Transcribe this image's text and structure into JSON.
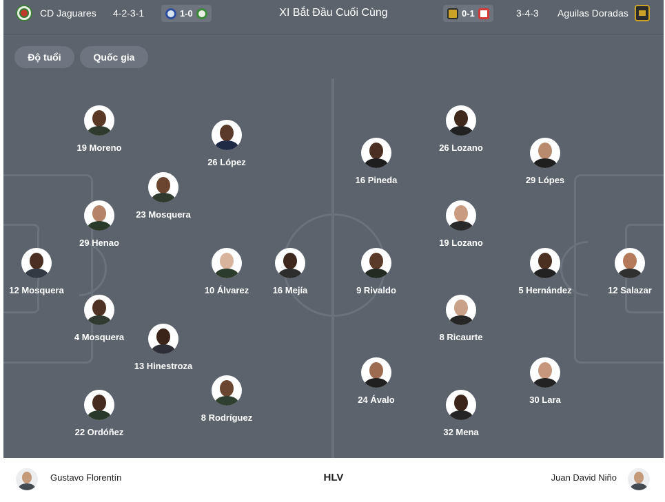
{
  "header": {
    "home_team": "CD Jaguares",
    "home_formation": "4-2-3-1",
    "home_last_score": "1-0",
    "title": "XI Bắt Đầu Cuối Cùng",
    "away_last_score": "0-1",
    "away_formation": "3-4-3",
    "away_team": "Aguilas Doradas"
  },
  "filters": [
    "Độ tuổi",
    "Quốc gia"
  ],
  "home_players": [
    {
      "label": "19 Moreno",
      "skin": "#5a3826",
      "shirt": "#2f3a2f"
    },
    {
      "label": "26 López",
      "skin": "#5b3a2a",
      "shirt": "#1f2a44"
    },
    {
      "label": "23 Mosquera",
      "skin": "#6b4530",
      "shirt": "#2e3b2e"
    },
    {
      "label": "29 Henao",
      "skin": "#b5836a",
      "shirt": "#2b3b2b"
    },
    {
      "label": "12 Mosquera",
      "skin": "#4a2f22",
      "shirt": "#333a44"
    },
    {
      "label": "10 Álvarez",
      "skin": "#d8b49c",
      "shirt": "#2c3c2c"
    },
    {
      "label": "16 Mejía",
      "skin": "#3e281d",
      "shirt": "#2d2d2d"
    },
    {
      "label": "4 Mosquera",
      "skin": "#4e3224",
      "shirt": "#303a30"
    },
    {
      "label": "13 Hinestroza",
      "skin": "#3a241a",
      "shirt": "#2e2e36"
    },
    {
      "label": "22 Ordóñez",
      "skin": "#442b1f",
      "shirt": "#2a3a2a"
    },
    {
      "label": "8 Rodríguez",
      "skin": "#6a452f",
      "shirt": "#304030"
    }
  ],
  "away_players": [
    {
      "label": "16 Pineda",
      "skin": "#4a2f22",
      "shirt": "#1e1e1e"
    },
    {
      "label": "26 Lozano",
      "skin": "#3f281c",
      "shirt": "#222222"
    },
    {
      "label": "29 Lópes",
      "skin": "#b88a6e",
      "shirt": "#1f1f1f"
    },
    {
      "label": "19 Lozano",
      "skin": "#c99b80",
      "shirt": "#2a2a2a"
    },
    {
      "label": "9 Rivaldo",
      "skin": "#5a3a28",
      "shirt": "#222a22"
    },
    {
      "label": "5 Hernández",
      "skin": "#4b2f20",
      "shirt": "#222222"
    },
    {
      "label": "12 Salazar",
      "skin": "#b47a5a",
      "shirt": "#303030"
    },
    {
      "label": "8 Ricaurte",
      "skin": "#c9a088",
      "shirt": "#262626"
    },
    {
      "label": "24 Ávalo",
      "skin": "#9c6b50",
      "shirt": "#202020"
    },
    {
      "label": "32 Mena",
      "skin": "#3b251a",
      "shirt": "#252525"
    },
    {
      "label": "30 Lara",
      "skin": "#c6977c",
      "shirt": "#232323"
    }
  ],
  "footer": {
    "home_coach": "Gustavo Florentín",
    "center_label": "HLV",
    "away_coach": "Juan David Niño"
  }
}
